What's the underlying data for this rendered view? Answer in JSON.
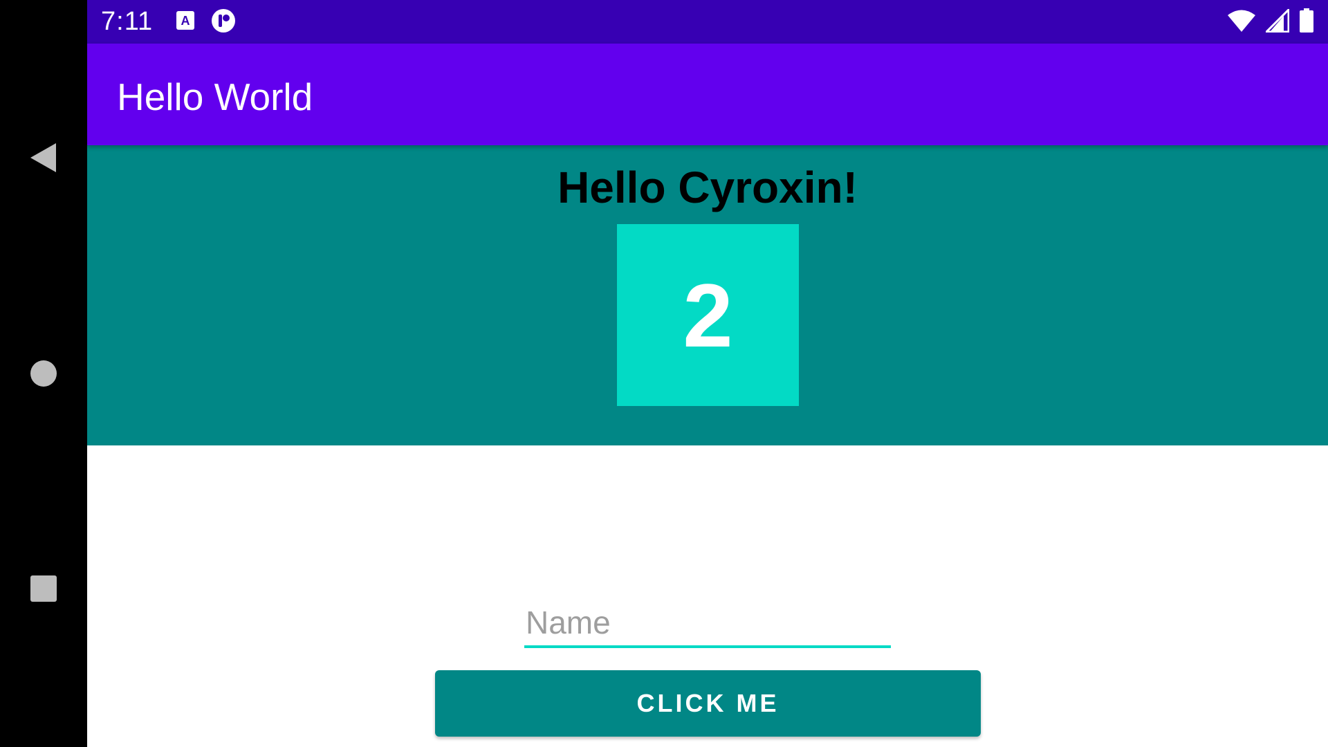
{
  "status_bar": {
    "time": "7:11",
    "icons": [
      "text-a-notification-icon",
      "app-notification-icon",
      "wifi-icon",
      "cell-signal-icon",
      "battery-icon"
    ]
  },
  "nav_bar": {
    "icons": [
      "back-icon",
      "home-icon",
      "recents-icon"
    ]
  },
  "app_bar": {
    "title": "Hello World",
    "color": "#6200ee",
    "status_color": "#3700b3"
  },
  "main": {
    "greeting": "Hello Cyroxin!",
    "counter": "2",
    "panel_color": "#018786",
    "box_color": "#03dac5"
  },
  "form": {
    "name_placeholder": "Name",
    "name_value": "",
    "button_label": "CLICK ME"
  }
}
